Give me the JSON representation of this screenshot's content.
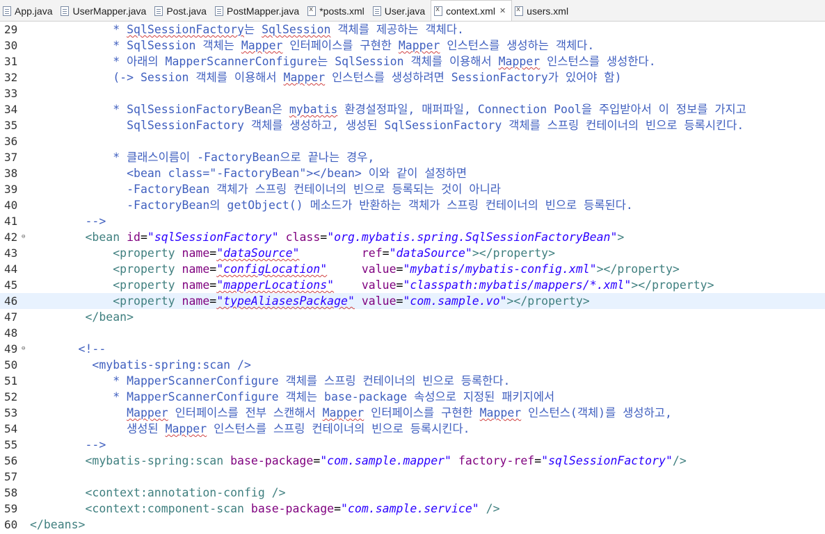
{
  "tabs": [
    {
      "label": "App.java",
      "icon": "java-file-icon"
    },
    {
      "label": "UserMapper.java",
      "icon": "java-file-icon"
    },
    {
      "label": "Post.java",
      "icon": "java-file-icon"
    },
    {
      "label": "PostMapper.java",
      "icon": "java-file-icon"
    },
    {
      "label": "*posts.xml",
      "icon": "xml-file-icon"
    },
    {
      "label": "User.java",
      "icon": "java-file-icon"
    },
    {
      "label": "context.xml",
      "icon": "xml-file-icon",
      "active": true,
      "close": "✕"
    },
    {
      "label": "users.xml",
      "icon": "xml-file-icon"
    }
  ],
  "editor": {
    "current_line": 46,
    "lines": [
      {
        "n": "29",
        "segs": [
          [
            "c",
            "            * "
          ],
          [
            "cs",
            "SqlSessionFactory"
          ],
          [
            "c",
            "는 "
          ],
          [
            "cs",
            "SqlSession"
          ],
          [
            "c",
            " 객체를 제공하는 객체다."
          ]
        ]
      },
      {
        "n": "30",
        "segs": [
          [
            "c",
            "            * SqlSession 객체는 "
          ],
          [
            "cs",
            "Mapper"
          ],
          [
            "c",
            " 인터페이스를 구현한 "
          ],
          [
            "cs",
            "Mapper"
          ],
          [
            "c",
            " 인스턴스를 생성하는 객체다."
          ]
        ]
      },
      {
        "n": "31",
        "segs": [
          [
            "c",
            "            * 아래의 MapperScannerConfigure는 SqlSession 객체를 이용해서 "
          ],
          [
            "cs",
            "Mapper"
          ],
          [
            "c",
            " 인스턴스를 생성한다."
          ]
        ]
      },
      {
        "n": "32",
        "segs": [
          [
            "c",
            "            (-> Session 객체를 이용해서 "
          ],
          [
            "cs",
            "Mapper"
          ],
          [
            "c",
            " 인스턴스를 생성하려면 SessionFactory가 있어야 함)"
          ]
        ]
      },
      {
        "n": "33",
        "segs": []
      },
      {
        "n": "34",
        "segs": [
          [
            "c",
            "            * SqlSessionFactoryBean은 "
          ],
          [
            "cs",
            "mybatis"
          ],
          [
            "c",
            " 환경설정파일, 매퍼파일, Connection Pool을 주입받아서 이 정보를 가지고"
          ]
        ]
      },
      {
        "n": "35",
        "segs": [
          [
            "c",
            "              SqlSessionFactory 객체를 생성하고, 생성된 SqlSessionFactory 객체를 스프링 컨테이너의 빈으로 등록시킨다."
          ]
        ]
      },
      {
        "n": "36",
        "segs": []
      },
      {
        "n": "37",
        "segs": [
          [
            "c",
            "            * 클래스이름이 -FactoryBean으로 끝나는 경우,"
          ]
        ]
      },
      {
        "n": "38",
        "segs": [
          [
            "c",
            "              <bean class=\"-FactoryBean\"></bean> 이와 같이 설정하면"
          ]
        ]
      },
      {
        "n": "39",
        "segs": [
          [
            "c",
            "              -FactoryBean 객체가 스프링 컨테이너의 빈으로 등록되는 것이 아니라"
          ]
        ]
      },
      {
        "n": "40",
        "segs": [
          [
            "c",
            "              -FactoryBean의 getObject() 메소드가 반환하는 객체가 스프링 컨테이너의 빈으로 등록된다."
          ]
        ]
      },
      {
        "n": "41",
        "segs": [
          [
            "c",
            "        -->"
          ]
        ]
      },
      {
        "n": "42",
        "fold": "⊖",
        "segs": [
          [
            "t",
            "        <bean "
          ],
          [
            "a",
            "id"
          ],
          [
            "e",
            "="
          ],
          [
            "v",
            "\"sqlSessionFactory\""
          ],
          [
            "t",
            " "
          ],
          [
            "a",
            "class"
          ],
          [
            "e",
            "="
          ],
          [
            "v",
            "\"org.mybatis.spring.SqlSessionFactoryBean\""
          ],
          [
            "t",
            ">"
          ]
        ]
      },
      {
        "n": "43",
        "segs": [
          [
            "t",
            "            <property "
          ],
          [
            "a",
            "name"
          ],
          [
            "e",
            "="
          ],
          [
            "vs",
            "\"dataSource\""
          ],
          [
            "t",
            "         "
          ],
          [
            "a",
            "ref"
          ],
          [
            "e",
            "="
          ],
          [
            "v",
            "\"dataSource\""
          ],
          [
            "t",
            "></property>"
          ]
        ]
      },
      {
        "n": "44",
        "segs": [
          [
            "t",
            "            <property "
          ],
          [
            "a",
            "name"
          ],
          [
            "e",
            "="
          ],
          [
            "vs",
            "\"configLocation\""
          ],
          [
            "t",
            "     "
          ],
          [
            "a",
            "value"
          ],
          [
            "e",
            "="
          ],
          [
            "v",
            "\"mybatis/mybatis-config.xml\""
          ],
          [
            "t",
            "></property>"
          ]
        ]
      },
      {
        "n": "45",
        "segs": [
          [
            "t",
            "            <property "
          ],
          [
            "a",
            "name"
          ],
          [
            "e",
            "="
          ],
          [
            "vs",
            "\"mapperLocations\""
          ],
          [
            "t",
            "    "
          ],
          [
            "a",
            "value"
          ],
          [
            "e",
            "="
          ],
          [
            "v",
            "\"classpath:mybatis/mappers/*.xml\""
          ],
          [
            "t",
            "></property>"
          ]
        ]
      },
      {
        "n": "46",
        "segs": [
          [
            "t",
            "            <property "
          ],
          [
            "a",
            "name"
          ],
          [
            "e",
            "="
          ],
          [
            "vs",
            "\"typeAliasesPackage\""
          ],
          [
            "t",
            " "
          ],
          [
            "a",
            "value"
          ],
          [
            "e",
            "="
          ],
          [
            "v",
            "\"com.sample.vo\""
          ],
          [
            "t",
            "></property>"
          ]
        ]
      },
      {
        "n": "47",
        "segs": [
          [
            "t",
            "        </bean>"
          ]
        ]
      },
      {
        "n": "48",
        "segs": []
      },
      {
        "n": "49",
        "fold": "⊖",
        "segs": [
          [
            "c",
            "       <!--"
          ]
        ]
      },
      {
        "n": "50",
        "segs": [
          [
            "c",
            "         <mybatis-spring:scan />"
          ]
        ]
      },
      {
        "n": "51",
        "segs": [
          [
            "c",
            "            * MapperScannerConfigure 객체를 스프링 컨테이너의 빈으로 등록한다."
          ]
        ]
      },
      {
        "n": "52",
        "segs": [
          [
            "c",
            "            * MapperScannerConfigure 객체는 base-package 속성으로 지정된 패키지에서"
          ]
        ]
      },
      {
        "n": "53",
        "segs": [
          [
            "c",
            "              "
          ],
          [
            "cs",
            "Mapper"
          ],
          [
            "c",
            " 인터페이스를 전부 스캔해서 "
          ],
          [
            "cs",
            "Mapper"
          ],
          [
            "c",
            " 인터페이스를 구현한 "
          ],
          [
            "cs",
            "Mapper"
          ],
          [
            "c",
            " 인스턴스(객체)를 생성하고,"
          ]
        ]
      },
      {
        "n": "54",
        "segs": [
          [
            "c",
            "              생성된 "
          ],
          [
            "cs",
            "Mapper"
          ],
          [
            "c",
            " 인스턴스를 스프링 컨테이너의 빈으로 등록시킨다."
          ]
        ]
      },
      {
        "n": "55",
        "segs": [
          [
            "c",
            "        -->"
          ]
        ]
      },
      {
        "n": "56",
        "segs": [
          [
            "t",
            "        <mybatis-spring:scan "
          ],
          [
            "a",
            "base-package"
          ],
          [
            "e",
            "="
          ],
          [
            "v",
            "\"com.sample.mapper\""
          ],
          [
            "t",
            " "
          ],
          [
            "a",
            "factory-ref"
          ],
          [
            "e",
            "="
          ],
          [
            "v",
            "\"sqlSessionFactory\""
          ],
          [
            "t",
            "/>"
          ]
        ]
      },
      {
        "n": "57",
        "segs": []
      },
      {
        "n": "58",
        "segs": [
          [
            "t",
            "        <context:annotation-config />"
          ]
        ]
      },
      {
        "n": "59",
        "segs": [
          [
            "t",
            "        <context:component-scan "
          ],
          [
            "a",
            "base-package"
          ],
          [
            "e",
            "="
          ],
          [
            "v",
            "\"com.sample.service\""
          ],
          [
            "t",
            " />"
          ]
        ]
      },
      {
        "n": "60",
        "segs": [
          [
            "t",
            "</beans>"
          ]
        ]
      }
    ]
  },
  "colors": {
    "comment": "#3f5fbf",
    "tag": "#3f7f7f",
    "attribute": "#7f007f",
    "value": "#2a00ff",
    "current_line_bg": "#e8f2fe"
  }
}
